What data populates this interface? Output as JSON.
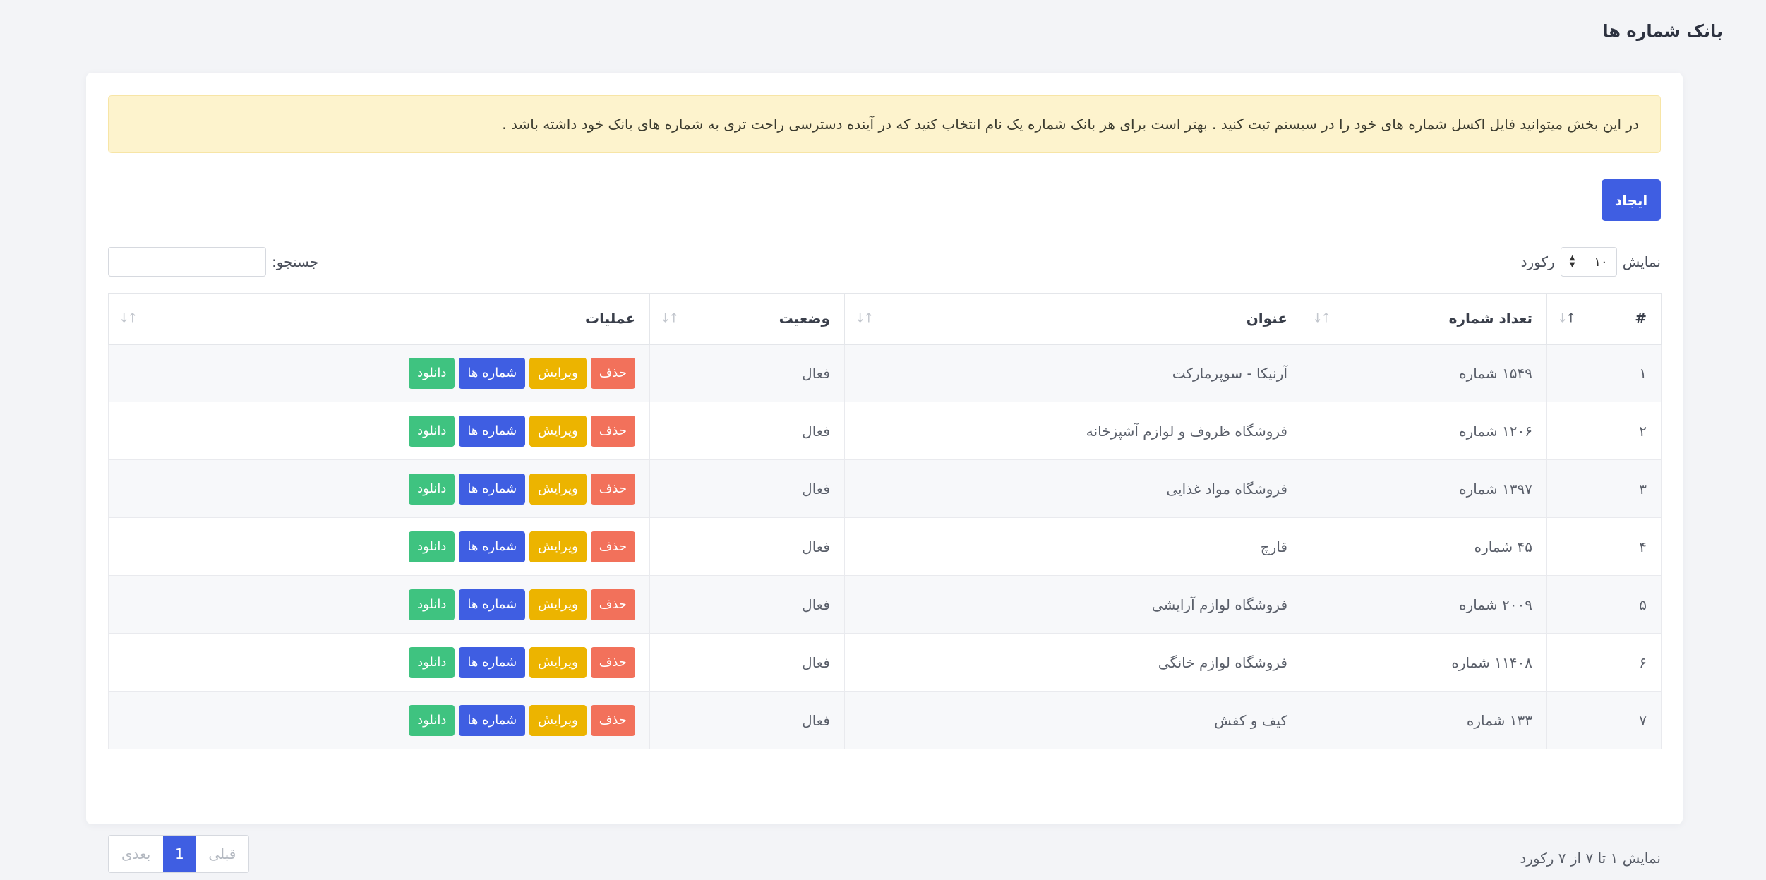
{
  "page": {
    "title": "بانک شماره ها"
  },
  "alert": {
    "text": "در این بخش میتوانید فایل اکسل شماره های خود را در سیستم ثبت کنید . بهتر است برای هر بانک شماره یک نام انتخاب کنید که در آینده دسترسی راحت تری به شماره های بانک خود داشته باشد ."
  },
  "toolbar": {
    "create_label": "ایجاد"
  },
  "length": {
    "show_label": "نمایش",
    "value": "۱۰",
    "records_label": "رکورد"
  },
  "search": {
    "label": "جستجو:",
    "value": "",
    "placeholder": ""
  },
  "table": {
    "headers": [
      "#",
      "تعداد شماره",
      "عنوان",
      "وضعیت",
      "عملیات"
    ],
    "rows": [
      {
        "index": "۱",
        "count": "۱۵۴۹ شماره",
        "title": "آرنیکا - سوپرمارکت",
        "status": "فعال"
      },
      {
        "index": "۲",
        "count": "۱۲۰۶ شماره",
        "title": "فروشگاه ظروف و لوازم آشپزخانه",
        "status": "فعال"
      },
      {
        "index": "۳",
        "count": "۱۳۹۷ شماره",
        "title": "فروشگاه مواد غذایی",
        "status": "فعال"
      },
      {
        "index": "۴",
        "count": "۴۵ شماره",
        "title": "قارچ",
        "status": "فعال"
      },
      {
        "index": "۵",
        "count": "۲۰۰۹ شماره",
        "title": "فروشگاه لوازم آرایشی",
        "status": "فعال"
      },
      {
        "index": "۶",
        "count": "۱۱۴۰۸ شماره",
        "title": "فروشگاه لوازم خانگی",
        "status": "فعال"
      },
      {
        "index": "۷",
        "count": "۱۳۳ شماره",
        "title": "کیف و کفش",
        "status": "فعال"
      }
    ],
    "actions": {
      "delete": "حذف",
      "edit": "ویرایش",
      "numbers": "شماره ها",
      "download": "دانلود"
    }
  },
  "footer": {
    "info": "نمایش ۱ تا ۷ از ۷ رکورد",
    "pager": {
      "previous": "قبلی",
      "current": "1",
      "next": "بعدی"
    }
  },
  "colors": {
    "primary": "#3f5ee2",
    "danger": "#f2715b",
    "warning": "#ecb400",
    "success": "#3fc380",
    "alert_bg": "#fdf3cd"
  },
  "icons": {
    "sort": "sort-arrows-icon",
    "select": "select-arrows-icon"
  }
}
